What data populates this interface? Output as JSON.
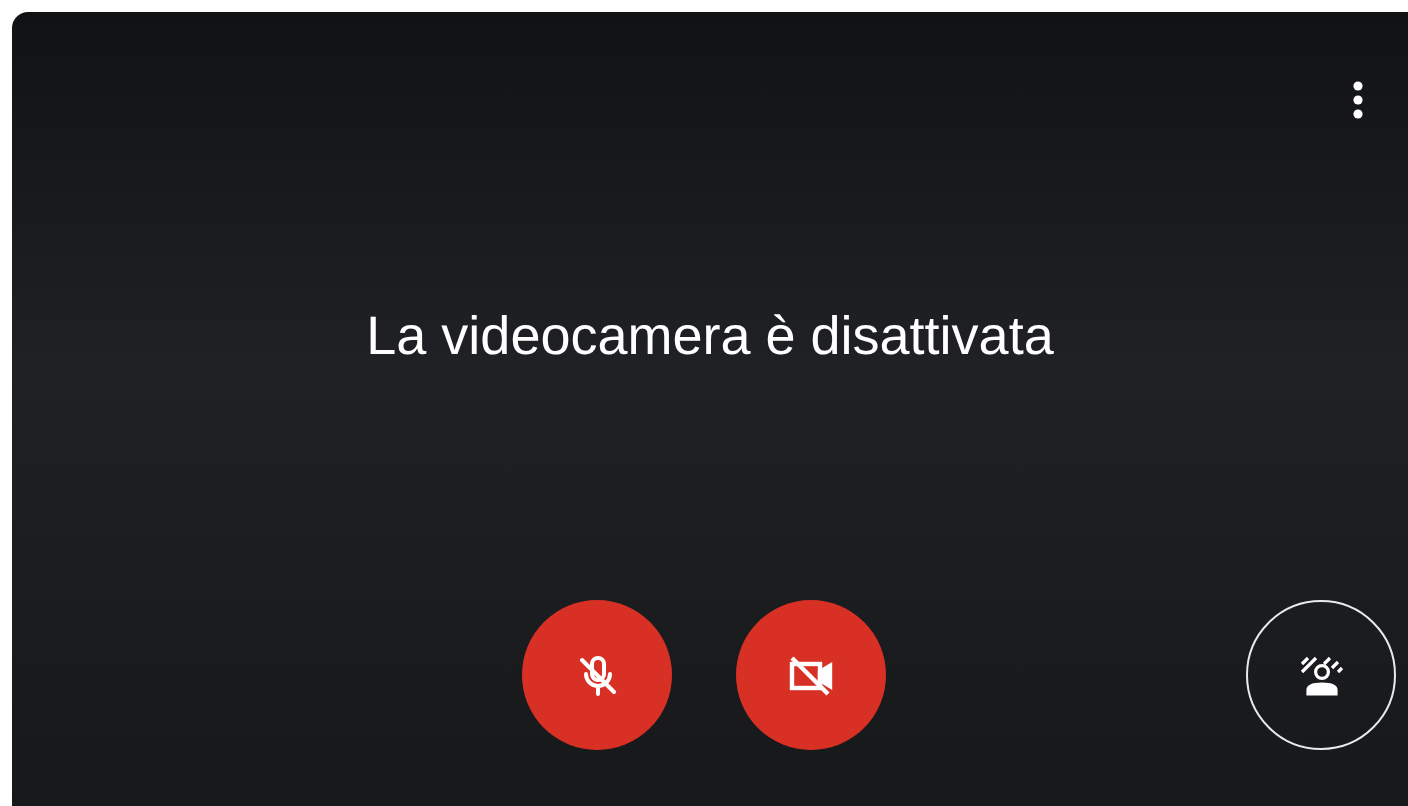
{
  "message": "La videocamera è disattivata",
  "controls": [
    {
      "kind": "mic",
      "on": false
    },
    {
      "kind": "camera",
      "on": false
    }
  ],
  "effects_button": {
    "kind": "effects"
  }
}
